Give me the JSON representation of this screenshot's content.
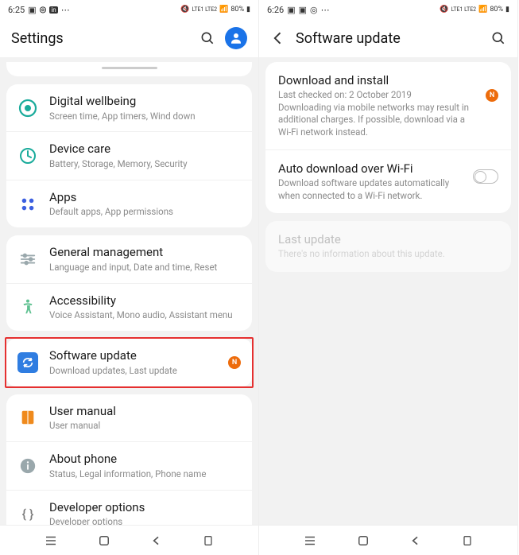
{
  "left": {
    "status": {
      "time": "6:25",
      "network": "LTE1 LTE2",
      "battery": "80%"
    },
    "header": {
      "title": "Settings"
    },
    "groups": [
      [
        {
          "key": "wellbeing",
          "title": "Digital wellbeing",
          "sub": "Screen time, App timers, Wind down"
        },
        {
          "key": "devicecare",
          "title": "Device care",
          "sub": "Battery, Storage, Memory, Security"
        },
        {
          "key": "apps",
          "title": "Apps",
          "sub": "Default apps, App permissions"
        }
      ],
      [
        {
          "key": "general",
          "title": "General management",
          "sub": "Language and input, Date and time, Reset"
        },
        {
          "key": "accessibility",
          "title": "Accessibility",
          "sub": "Voice Assistant, Mono audio, Assistant menu"
        }
      ],
      [
        {
          "key": "swupdate",
          "title": "Software update",
          "sub": "Download updates, Last update",
          "badge": "N",
          "highlight": true
        }
      ],
      [
        {
          "key": "usermanual",
          "title": "User manual",
          "sub": "User manual"
        },
        {
          "key": "about",
          "title": "About phone",
          "sub": "Status, Legal information, Phone name"
        },
        {
          "key": "devopts",
          "title": "Developer options",
          "sub": "Developer options"
        }
      ]
    ]
  },
  "right": {
    "status": {
      "time": "6:26",
      "network": "LTE1 LTE2",
      "battery": "80%"
    },
    "header": {
      "title": "Software update"
    },
    "items": [
      {
        "key": "download",
        "title": "Download and install",
        "sub": "Last checked on: 2 October 2019\nDownloading via mobile networks may result in additional charges. If possible, download via a Wi-Fi network instead.",
        "badge": "N"
      },
      {
        "key": "autodl",
        "title": "Auto download over Wi-Fi",
        "sub": "Download software updates automatically when connected to a Wi-Fi network.",
        "toggle": false
      }
    ],
    "lastupdate": {
      "title": "Last update",
      "sub": "There's no information about this update."
    }
  },
  "icons": {
    "wellbeing": "#1aab9b",
    "devicecare": "#1aab9b",
    "apps": "#3b5fe0",
    "general": "#9aa8ac",
    "accessibility": "#5fc191",
    "swupdate": "#2f7de1",
    "usermanual": "#ef8a1d",
    "about": "#9aa8ac",
    "devopts": "#7a7a7a"
  }
}
